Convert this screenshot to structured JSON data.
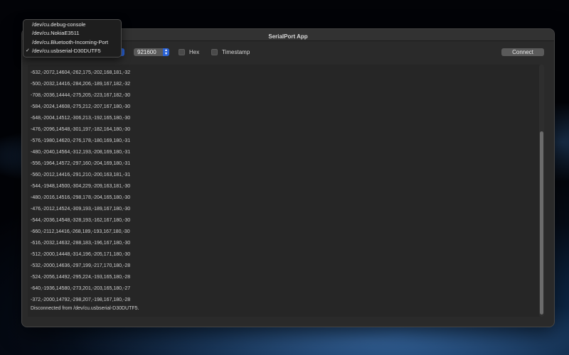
{
  "window": {
    "title": "SerialPort App"
  },
  "toolbar": {
    "baud_value": "921600",
    "hex_label": "Hex",
    "timestamp_label": "Timestamp",
    "connect_label": "Connect"
  },
  "port_menu": {
    "items": [
      {
        "label": "/dev/cu.debug-console",
        "checked": false
      },
      {
        "label": "/dev/cu.NokiaE3511",
        "checked": false
      },
      {
        "label": "/dev/cu.Bluetooth-Incoming-Port",
        "checked": false
      },
      {
        "label": "/dev/cu.usbserial-D30DUTF5",
        "checked": true
      }
    ],
    "check_mark": "✓"
  },
  "console": {
    "lines": [
      "-632,-2072,14604,-262,175,-202,168,181,-32",
      "-500,-2032,14416,-284,206,-189,167,182,-32",
      "-708,-2036,14444,-275,205,-223,167,182,-30",
      "-584,-2024,14608,-275,212,-207,167,180,-30",
      "-648,-2004,14512,-306,213,-192,165,180,-30",
      "-476,-2096,14548,-301,197,-182,164,180,-30",
      "-576,-1980,14620,-276,178,-180,169,180,-31",
      "-480,-2040,14564,-312,193,-208,169,180,-31",
      "-556,-1964,14572,-297,160,-204,169,180,-31",
      "-560,-2012,14416,-291,210,-200,163,181,-31",
      "-544,-1948,14500,-304,229,-209,163,181,-30",
      "-480,-2016,14516,-298,178,-204,165,180,-30",
      "-476,-2012,14524,-309,193,-189,167,180,-30",
      "-544,-2036,14548,-328,193,-162,167,180,-30",
      "-660,-2112,14416,-268,189,-193,167,180,-30",
      "-616,-2032,14632,-288,183,-196,167,180,-30",
      "-512,-2000,14448,-314,196,-205,171,180,-30",
      "-532,-2000,14636,-297,199,-217,170,180,-28",
      "-524,-2056,14492,-295,224,-193,165,180,-28",
      "-640,-1936,14580,-273,201,-203,165,180,-27",
      "-372,-2000,14792,-298,207,-198,167,180,-28"
    ],
    "status": "Disconnected from /dev/cu.usbserial-D30DUTF5."
  },
  "colors": {
    "accent": "#2b63d6",
    "window_bg": "#2a2a2a",
    "console_bg": "#262626",
    "text": "#d2d2d2"
  }
}
